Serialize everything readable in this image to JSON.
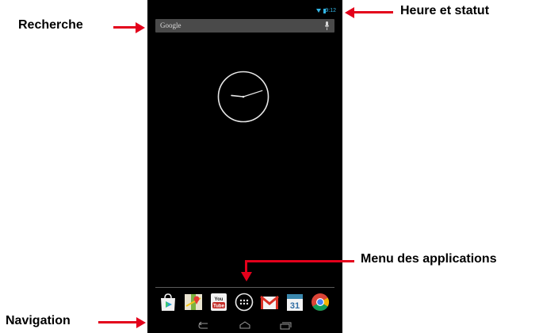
{
  "annotations": {
    "search": "Recherche",
    "time_status": "Heure et statut",
    "app_menu": "Menu des applications",
    "navigation": "Navigation"
  },
  "status_bar": {
    "time": "9:12",
    "icons": [
      "wifi-icon",
      "battery-icon"
    ]
  },
  "search_bar": {
    "text": "Google",
    "icon": "mic-icon"
  },
  "clock": {
    "type": "analog",
    "hour": 9,
    "minute": 12
  },
  "dock": {
    "apps": [
      {
        "name": "play-store-icon"
      },
      {
        "name": "maps-icon"
      },
      {
        "name": "youtube-icon",
        "text": "You Tube"
      },
      {
        "name": "app-drawer-icon"
      },
      {
        "name": "gmail-icon"
      },
      {
        "name": "calendar-icon",
        "text": "31"
      },
      {
        "name": "chrome-icon"
      }
    ]
  },
  "navigation_bar": {
    "buttons": [
      "back-icon",
      "home-icon",
      "recent-apps-icon"
    ]
  },
  "colors": {
    "arrow": "#e3001b",
    "status_accent": "#33b5e5",
    "screen_bg": "#000000"
  }
}
